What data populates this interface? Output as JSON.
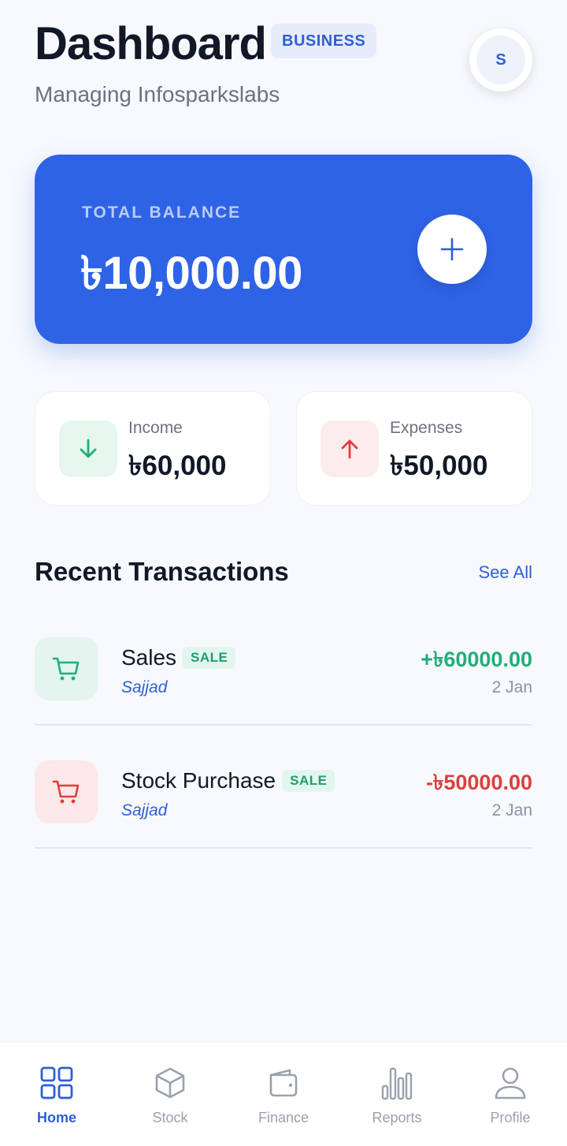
{
  "header": {
    "title": "Dashboard",
    "badge": "BUSINESS",
    "subtitle": "Managing Infosparkslabs",
    "avatar_initial": "S"
  },
  "balance": {
    "label": "TOTAL BALANCE",
    "value": "৳10,000.00",
    "add_icon": "plus-icon"
  },
  "stats": {
    "income": {
      "label": "Income",
      "value": "৳60,000",
      "icon": "arrow-down-icon",
      "color": "#1fae7a"
    },
    "expenses": {
      "label": "Expenses",
      "value": "৳50,000",
      "icon": "arrow-up-icon",
      "color": "#dc3f3f"
    }
  },
  "transactions": {
    "title": "Recent Transactions",
    "see_all": "See All",
    "items": [
      {
        "name": "Sales",
        "tag": "SALE",
        "person": "Sajjad",
        "amount": "+৳60000.00",
        "date": "2 Jan",
        "icon": "cart-icon",
        "color": "#1fae7a"
      },
      {
        "name": "Stock Purchase",
        "tag": "SALE",
        "person": "Sajjad",
        "amount": "-৳50000.00",
        "date": "2 Jan",
        "icon": "cart-icon",
        "color": "#dc3f3f"
      }
    ]
  },
  "nav": {
    "items": [
      {
        "label": "Home",
        "icon": "grid-icon",
        "active": true
      },
      {
        "label": "Stock",
        "icon": "box-icon"
      },
      {
        "label": "Finance",
        "icon": "wallet-icon"
      },
      {
        "label": "Reports",
        "icon": "bar-chart-icon"
      },
      {
        "label": "Profile",
        "icon": "user-icon"
      }
    ]
  },
  "colors": {
    "primary": "#2f63e6",
    "accent_text": "#2f5fd6",
    "income": "#1fae7a",
    "expense": "#dc3f3f"
  }
}
